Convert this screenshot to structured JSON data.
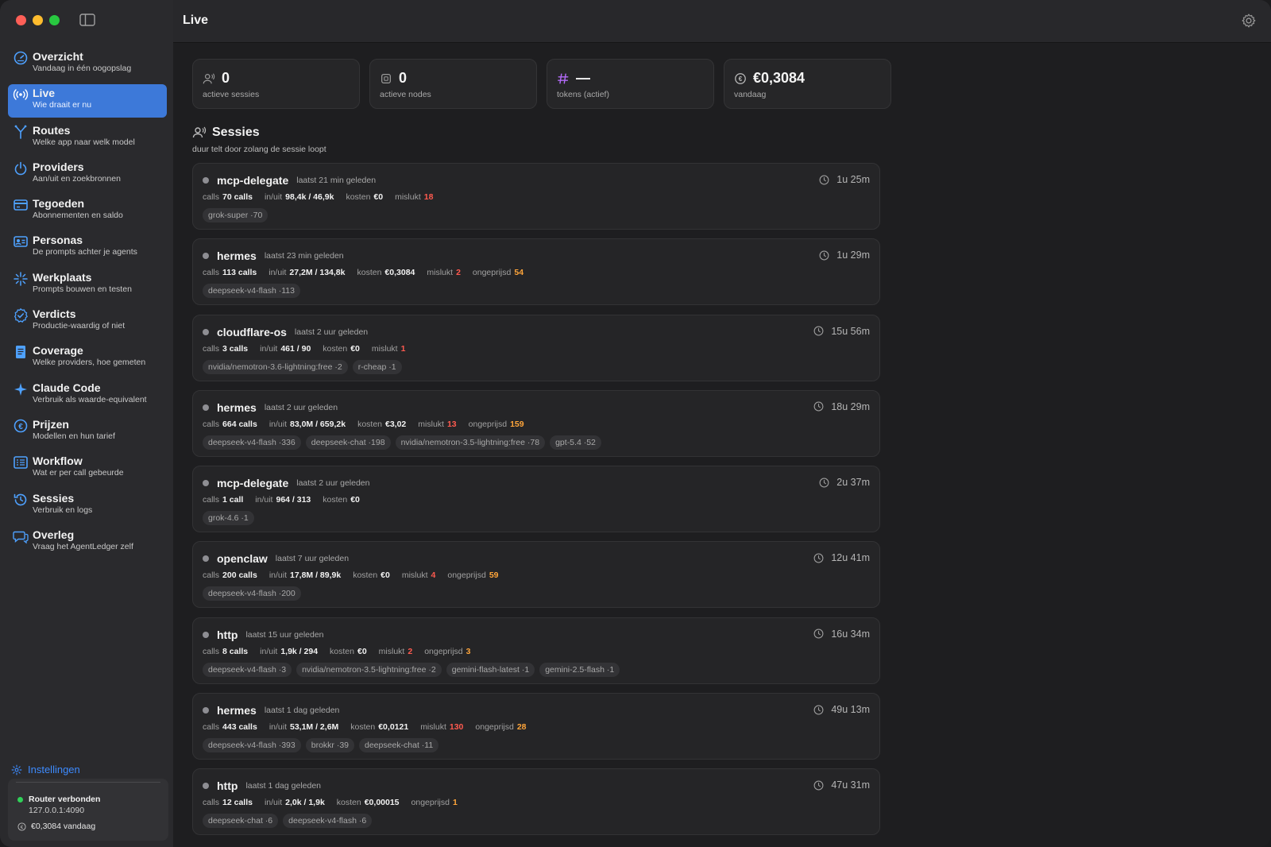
{
  "window": {
    "title": "Live"
  },
  "sidebar": {
    "items": [
      {
        "label": "Overzicht",
        "sub": "Vandaag in één oogopslag",
        "icon": "dashboard-icon"
      },
      {
        "label": "Live",
        "sub": "Wie draait er nu",
        "icon": "broadcast-icon",
        "active": true
      },
      {
        "label": "Routes",
        "sub": "Welke app naar welk model",
        "icon": "routes-icon"
      },
      {
        "label": "Providers",
        "sub": "Aan/uit en zoekbronnen",
        "icon": "power-icon"
      },
      {
        "label": "Tegoeden",
        "sub": "Abonnementen en saldo",
        "icon": "credit-card-icon"
      },
      {
        "label": "Personas",
        "sub": "De prompts achter je agents",
        "icon": "person-card-icon"
      },
      {
        "label": "Werkplaats",
        "sub": "Prompts bouwen en testen",
        "icon": "sparkle-icon"
      },
      {
        "label": "Verdicts",
        "sub": "Productie-waardig of niet",
        "icon": "check-badge-icon"
      },
      {
        "label": "Coverage",
        "sub": "Welke providers, hoe gemeten",
        "icon": "document-icon"
      },
      {
        "label": "Claude Code",
        "sub": "Verbruik als waarde-equivalent",
        "icon": "star-icon"
      },
      {
        "label": "Prijzen",
        "sub": "Modellen en hun tarief",
        "icon": "euro-icon"
      },
      {
        "label": "Workflow",
        "sub": "Wat er per call gebeurde",
        "icon": "list-icon"
      },
      {
        "label": "Sessies",
        "sub": "Verbruik en logs",
        "icon": "history-icon"
      },
      {
        "label": "Overleg",
        "sub": "Vraag het AgentLedger zelf",
        "icon": "chat-icon"
      }
    ],
    "settings_label": "Instellingen",
    "status": {
      "router": "Router verbonden",
      "address": "127.0.0.1:4090",
      "today": "€0,3084 vandaag"
    }
  },
  "stats": [
    {
      "value": "0",
      "label": "actieve sessies",
      "icon": "people-icon"
    },
    {
      "value": "0",
      "label": "actieve nodes",
      "icon": "node-icon"
    },
    {
      "value": "—",
      "label": "tokens (actief)",
      "icon": "hash-icon"
    },
    {
      "value": "€0,3084",
      "label": "vandaag",
      "icon": "euro-circle-icon"
    }
  ],
  "section": {
    "title": "Sessies",
    "subtitle": "duur telt door zolang de sessie loopt"
  },
  "labels": {
    "calls": "calls",
    "inout": "in/uit",
    "cost": "kosten",
    "failed": "mislukt",
    "unpriced": "ongeprijsd"
  },
  "colors": {
    "accent": "#3d79d9",
    "danger": "#ff5a4f",
    "warning": "#ffa53a",
    "ok": "#30d158"
  },
  "sessions": [
    {
      "name": "mcp-delegate",
      "last": "laatst 21 min geleden",
      "duration": "1u 25m",
      "calls": "70 calls",
      "inout": "98,4k / 46,9k",
      "cost": "€0",
      "failed": "18",
      "unpriced": null,
      "tags": [
        "grok-super ·70"
      ]
    },
    {
      "name": "hermes",
      "last": "laatst 23 min geleden",
      "duration": "1u 29m",
      "calls": "113 calls",
      "inout": "27,2M / 134,8k",
      "cost": "€0,3084",
      "failed": "2",
      "unpriced": "54",
      "tags": [
        "deepseek-v4-flash ·113"
      ]
    },
    {
      "name": "cloudflare-os",
      "last": "laatst 2 uur geleden",
      "duration": "15u 56m",
      "calls": "3 calls",
      "inout": "461 / 90",
      "cost": "€0",
      "failed": "1",
      "unpriced": null,
      "tags": [
        "nvidia/nemotron-3.6-lightning:free ·2",
        "r-cheap ·1"
      ]
    },
    {
      "name": "hermes",
      "last": "laatst 2 uur geleden",
      "duration": "18u 29m",
      "calls": "664 calls",
      "inout": "83,0M / 659,2k",
      "cost": "€3,02",
      "failed": "13",
      "unpriced": "159",
      "tags": [
        "deepseek-v4-flash ·336",
        "deepseek-chat ·198",
        "nvidia/nemotron-3.5-lightning:free ·78",
        "gpt-5.4 ·52"
      ]
    },
    {
      "name": "mcp-delegate",
      "last": "laatst 2 uur geleden",
      "duration": "2u 37m",
      "calls": "1 call",
      "inout": "964 / 313",
      "cost": "€0",
      "failed": null,
      "unpriced": null,
      "tags": [
        "grok-4.6 ·1"
      ]
    },
    {
      "name": "openclaw",
      "last": "laatst 7 uur geleden",
      "duration": "12u 41m",
      "calls": "200 calls",
      "inout": "17,8M / 89,9k",
      "cost": "€0",
      "failed": "4",
      "unpriced": "59",
      "tags": [
        "deepseek-v4-flash ·200"
      ]
    },
    {
      "name": "http",
      "last": "laatst 15 uur geleden",
      "duration": "16u 34m",
      "calls": "8 calls",
      "inout": "1,9k / 294",
      "cost": "€0",
      "failed": "2",
      "unpriced": "3",
      "tags": [
        "deepseek-v4-flash ·3",
        "nvidia/nemotron-3.5-lightning:free ·2",
        "gemini-flash-latest ·1",
        "gemini-2.5-flash ·1"
      ]
    },
    {
      "name": "hermes",
      "last": "laatst 1 dag geleden",
      "duration": "49u 13m",
      "calls": "443 calls",
      "inout": "53,1M / 2,6M",
      "cost": "€0,0121",
      "failed": "130",
      "unpriced": "28",
      "tags": [
        "deepseek-v4-flash ·393",
        "brokkr ·39",
        "deepseek-chat ·11"
      ]
    },
    {
      "name": "http",
      "last": "laatst 1 dag geleden",
      "duration": "47u 31m",
      "calls": "12 calls",
      "inout": "2,0k / 1,9k",
      "cost": "€0,00015",
      "failed": null,
      "unpriced": "1",
      "tags": [
        "deepseek-chat ·6",
        "deepseek-v4-flash ·6"
      ]
    }
  ]
}
